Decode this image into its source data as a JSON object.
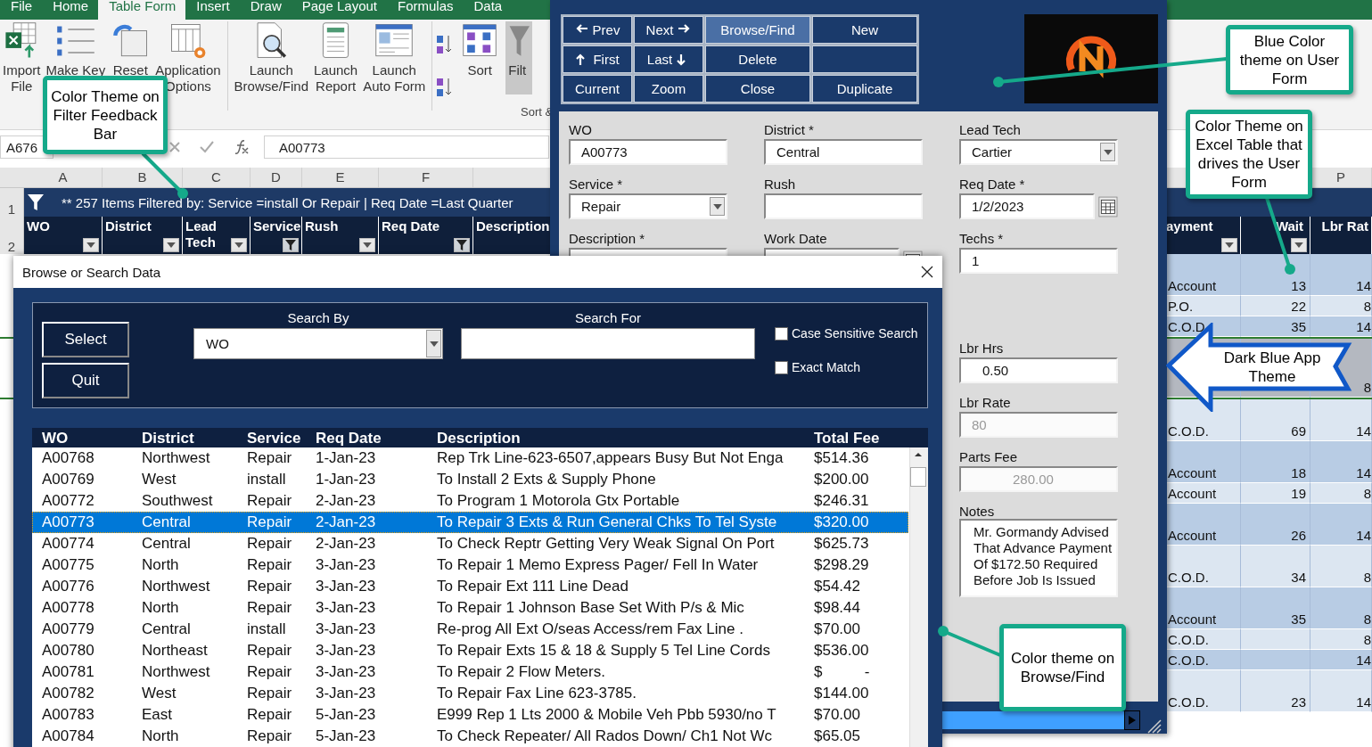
{
  "excel": {
    "ribbon_tabs": [
      {
        "label": "File",
        "selected": false
      },
      {
        "label": "Home",
        "selected": false
      },
      {
        "label": "Table Form",
        "selected": true
      },
      {
        "label": "Insert",
        "selected": false
      },
      {
        "label": "Draw",
        "selected": false
      },
      {
        "label": "Page Layout",
        "selected": false
      },
      {
        "label": "Formulas",
        "selected": false
      },
      {
        "label": "Data",
        "selected": false
      }
    ],
    "ribbon_buttons": [
      {
        "label": "Import\nFile",
        "kind": "import"
      },
      {
        "label": "Make Key",
        "kind": "list"
      },
      {
        "label": "Reset",
        "kind": "reset"
      },
      {
        "label": "Application\nOptions",
        "kind": "options"
      },
      {
        "label": "Launch\nBrowse/Find",
        "kind": "browse"
      },
      {
        "label": "Launch\nReport",
        "kind": "report"
      },
      {
        "label": "Launch\nAuto Form",
        "kind": "form"
      },
      {
        "label": "Sort",
        "kind": "sort"
      },
      {
        "label": "Filt",
        "kind": "filter"
      }
    ],
    "ribbon_group_label": "Sort &",
    "name_box": "A676",
    "formula": "A00773",
    "column_letters": [
      "A",
      "B",
      "C",
      "D",
      "E",
      "F"
    ],
    "last_column_letter": "P",
    "row_numbers": [
      "1",
      "2"
    ],
    "filter_bar": "** 257 Items Filtered by: Service =install Or Repair | Req Date =Last Quarter",
    "headers": [
      {
        "label": "WO",
        "filtered": false
      },
      {
        "label": "District",
        "filtered": false
      },
      {
        "label": "Lead Tech",
        "filtered": false
      },
      {
        "label": "Service",
        "filtered": true
      },
      {
        "label": "Rush",
        "filtered": false
      },
      {
        "label": "Req Date",
        "filtered": true
      },
      {
        "label": "Description"
      }
    ],
    "right_headers": [
      {
        "label": "ayment",
        "filtered": false
      },
      {
        "label": "Wait",
        "filtered": false
      },
      {
        "label": "Lbr Rat"
      }
    ],
    "rows": [
      {
        "payment": "Account",
        "wait": "13",
        "lbr_rate": "14",
        "kind": "double",
        "selected": false
      },
      {
        "payment": "P.O.",
        "wait": "22",
        "lbr_rate": "8",
        "kind": "single",
        "selected": false
      },
      {
        "payment": "C.O.D",
        "wait": "35",
        "lbr_rate": "14",
        "kind": "single",
        "selected": false
      },
      {
        "lbr_rate": "8",
        "kind": "triple",
        "selected": true
      },
      {
        "payment": "C.O.D.",
        "wait": "69",
        "lbr_rate": "14",
        "kind": "double",
        "selected": false
      },
      {
        "payment": "Account",
        "wait": "18",
        "lbr_rate": "14",
        "kind": "double",
        "selected": false
      },
      {
        "payment": "Account",
        "wait": "19",
        "lbr_rate": "8",
        "kind": "single",
        "selected": false
      },
      {
        "payment": "Account",
        "wait": "26",
        "lbr_rate": "14",
        "kind": "double",
        "selected": false
      },
      {
        "payment": "C.O.D.",
        "wait": "34",
        "lbr_rate": "8",
        "kind": "double",
        "selected": false
      },
      {
        "payment": "Account",
        "wait": "35",
        "lbr_rate": "8",
        "kind": "double",
        "selected": false
      },
      {
        "payment": "C.O.D.",
        "lbr_rate": "8",
        "kind": "single",
        "selected": false
      },
      {
        "payment": "C.O.D.",
        "lbr_rate": "14",
        "kind": "single",
        "selected": false
      },
      {
        "payment": "C.O.D.",
        "wait": "23",
        "lbr_rate": "14",
        "kind": "double",
        "selected": false
      }
    ]
  },
  "user_form": {
    "buttons": [
      {
        "label": "Prev",
        "kind": "prev",
        "selected": false
      },
      {
        "label": "Next",
        "kind": "next",
        "selected": false
      },
      {
        "label": "Browse/Find",
        "kind": "plain",
        "selected": true
      },
      {
        "label": "New",
        "kind": "plain",
        "selected": false
      },
      {
        "label": "First",
        "kind": "first",
        "selected": false
      },
      {
        "label": "Last",
        "kind": "last",
        "selected": false
      },
      {
        "label": "Delete",
        "kind": "plain",
        "selected": false
      },
      {
        "kind": "blank",
        "selected": false
      },
      {
        "label": "Current",
        "kind": "plain",
        "selected": false
      },
      {
        "label": "Zoom",
        "kind": "plain",
        "selected": false
      },
      {
        "label": "Close",
        "kind": "plain",
        "selected": false
      },
      {
        "label": "Duplicate",
        "kind": "plain",
        "selected": false
      }
    ],
    "columns": [
      {
        "fields": [
          {
            "label": "WO",
            "value": "A00773",
            "kind": "text",
            "disabled": false
          },
          {
            "label": "Service *",
            "value": "Repair",
            "kind": "dropdown",
            "disabled": false
          },
          {
            "label": "Description *",
            "kind": "text"
          }
        ]
      },
      {
        "fields": [
          {
            "label": "District *",
            "value": "Central",
            "kind": "text",
            "disabled": false
          },
          {
            "label": "Rush",
            "kind": "text"
          },
          {
            "label": "Work Date",
            "kind": "date"
          }
        ]
      },
      {
        "fields": [
          {
            "label": "Lead Tech",
            "value": "Cartier",
            "kind": "dropdown",
            "disabled": false
          },
          {
            "label": "Req Date *",
            "value": "1/2/2023",
            "kind": "date",
            "disabled": false
          },
          {
            "label": "Techs *",
            "value": "1",
            "kind": "text",
            "disabled": false
          },
          {
            "label": "Lbr Hrs",
            "value": "0.50",
            "kind": "number",
            "disabled": false
          },
          {
            "label": "Lbr Rate",
            "value": "80",
            "kind": "text",
            "disabled": true
          },
          {
            "label": "Parts Fee",
            "value": "280.00",
            "kind": "number",
            "disabled": true
          },
          {
            "label": "Notes",
            "value": "Mr. Gormandy Advised That Advance Payment Of $172.50 Required Before Job Is Issued",
            "kind": "notes",
            "disabled": false
          }
        ]
      }
    ]
  },
  "browse_window": {
    "title": "Browse or Search Data",
    "buttons": [
      "Select",
      "Quit"
    ],
    "search_by": {
      "label": "Search By",
      "value": "WO"
    },
    "search_for": {
      "label": "Search For"
    },
    "options": [
      {
        "label": "Case Sensitive Search",
        "checked": false
      },
      {
        "label": "Exact Match",
        "checked": false
      }
    ],
    "columns": [
      "WO",
      "District",
      "Service",
      "Req Date",
      "Description",
      "Total Fee"
    ],
    "rows": [
      {
        "cells": [
          "A00768",
          "Northwest",
          "Repair",
          "1-Jan-23",
          "Rep Trk Line-623-6507,appears Busy But Not Enga",
          "$514.36"
        ],
        "selected": false
      },
      {
        "cells": [
          "A00769",
          "West",
          "install",
          "1-Jan-23",
          "To Install 2 Exts & Supply Phone",
          "$200.00"
        ],
        "selected": false
      },
      {
        "cells": [
          "A00772",
          "Southwest",
          "Repair",
          "2-Jan-23",
          "To Program 1 Motorola Gtx Portable",
          "$246.31"
        ],
        "selected": false
      },
      {
        "cells": [
          "A00773",
          "Central",
          "Repair",
          "2-Jan-23",
          "To Repair 3 Exts & Run General Chks To Tel Syste",
          "$320.00"
        ],
        "selected": true
      },
      {
        "cells": [
          "A00774",
          "Central",
          "Repair",
          "2-Jan-23",
          "To Check Reptr Getting Very Weak Signal On Port",
          "$625.73"
        ],
        "selected": false
      },
      {
        "cells": [
          "A00775",
          "North",
          "Repair",
          "3-Jan-23",
          "To Repair 1 Memo Express Pager/ Fell In Water",
          "$298.29"
        ],
        "selected": false
      },
      {
        "cells": [
          "A00776",
          "Northwest",
          "Repair",
          "3-Jan-23",
          "To Repair Ext 111 Line Dead",
          "$54.42"
        ],
        "selected": false
      },
      {
        "cells": [
          "A00778",
          "North",
          "Repair",
          "3-Jan-23",
          "To Repair 1 Johnson Base Set With P/s & Mic",
          "$98.44"
        ],
        "selected": false
      },
      {
        "cells": [
          "A00779",
          "Central",
          "install",
          "3-Jan-23",
          "Re-prog All Ext O/seas Access/rem Fax Line .",
          "$70.00"
        ],
        "selected": false
      },
      {
        "cells": [
          "A00780",
          "Northeast",
          "Repair",
          "3-Jan-23",
          "To Repair Exts 15 & 18 & Supply 5 Tel Line Cords",
          "$536.00"
        ],
        "selected": false
      },
      {
        "cells": [
          "A00781",
          "Northwest",
          "Repair",
          "3-Jan-23",
          "To Repair 2 Flow Meters.",
          "$          -"
        ],
        "selected": false
      },
      {
        "cells": [
          "A00782",
          "West",
          "Repair",
          "3-Jan-23",
          "To Repair Fax Line 623-3785.",
          "$144.00"
        ],
        "selected": false
      },
      {
        "cells": [
          "A00783",
          "East",
          "Repair",
          "5-Jan-23",
          "E999 Rep 1 Lts 2000 & Mobile Veh Pbb 5930/no T",
          "$70.00"
        ],
        "selected": false
      },
      {
        "cells": [
          "A00784",
          "North",
          "Repair",
          "5-Jan-23",
          "To Check Repeater/ All Rados Down/ Ch1 Not Wc",
          "$65.05"
        ],
        "selected": false
      }
    ]
  },
  "callouts": [
    {
      "text": "Color Theme on Filter Feedback Bar",
      "kind": "filter"
    },
    {
      "text": "Blue Color theme on User Form",
      "kind": "form"
    },
    {
      "text": "Color Theme on Excel Table that  drives the User Form",
      "kind": "table"
    },
    {
      "text": "Dark Blue App Theme",
      "kind": "arrow"
    },
    {
      "text": "Color theme on Browse/Find",
      "kind": "browse"
    }
  ]
}
